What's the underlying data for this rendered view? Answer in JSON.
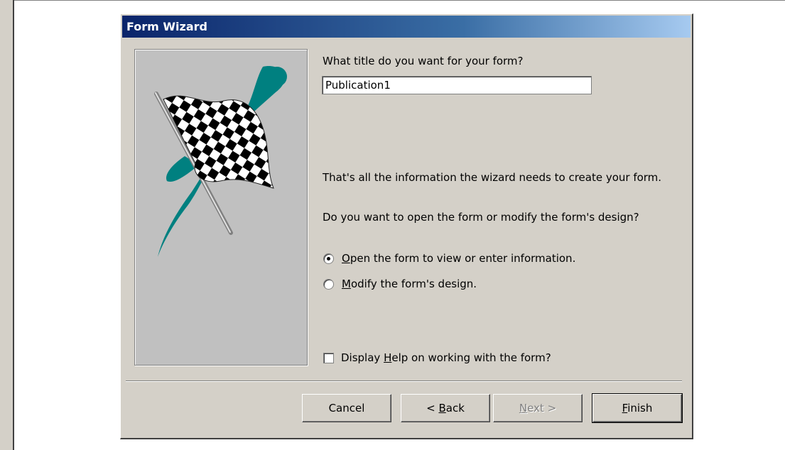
{
  "window": {
    "title": "Form Wizard"
  },
  "question_title": "What title do you want for your form?",
  "title_input": {
    "value": "Publication1"
  },
  "info_text": "That's all the information the wizard needs to create your form.",
  "open_question": "Do you want to open the form or modify the form's design?",
  "options": [
    {
      "pre": "",
      "key": "O",
      "post": "pen the form to view or enter information.",
      "selected": true
    },
    {
      "pre": "",
      "key": "M",
      "post": "odify the form's design.",
      "selected": false
    }
  ],
  "help_checkbox": {
    "pre": "Display ",
    "key": "H",
    "post": "elp on working with the form?",
    "checked": false
  },
  "buttons": {
    "cancel": "Cancel",
    "back": {
      "pre": "< ",
      "key": "B",
      "post": "ack"
    },
    "next": {
      "pre": "",
      "key": "N",
      "post": "ext >"
    },
    "finish": {
      "pre": "",
      "key": "F",
      "post": "inish"
    }
  },
  "colors": {
    "teal": "#008080",
    "title_start": "#0a246a",
    "title_end": "#a6caf0",
    "face": "#d4d0c8"
  }
}
